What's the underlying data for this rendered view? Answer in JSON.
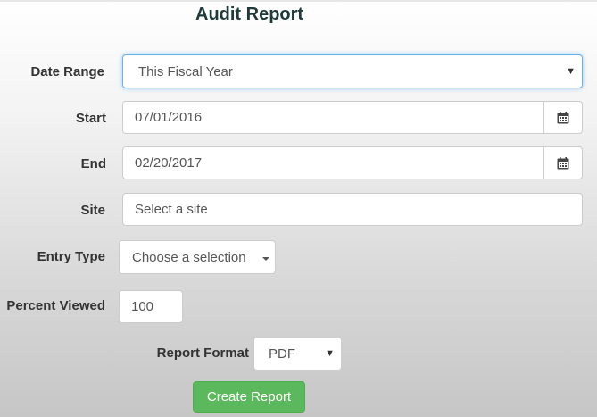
{
  "title": "Audit Report",
  "form": {
    "date_range": {
      "label": "Date Range",
      "value": "This Fiscal Year"
    },
    "start": {
      "label": "Start",
      "value": "07/01/2016"
    },
    "end": {
      "label": "End",
      "value": "02/20/2017"
    },
    "site": {
      "label": "Site",
      "placeholder": "Select a site"
    },
    "entry_type": {
      "label": "Entry Type",
      "value": "Choose a selection"
    },
    "percent_viewed": {
      "label": "Percent Viewed",
      "value": "100"
    },
    "report_format": {
      "label": "Report Format",
      "value": "PDF"
    }
  },
  "actions": {
    "create_label": "Create Report"
  },
  "icons": {
    "calendar": "calendar-icon",
    "dropdown": "caret-down-icon"
  },
  "colors": {
    "accent": "#5cb85c",
    "focus": "#66afe9",
    "title": "#1f3a3a"
  }
}
